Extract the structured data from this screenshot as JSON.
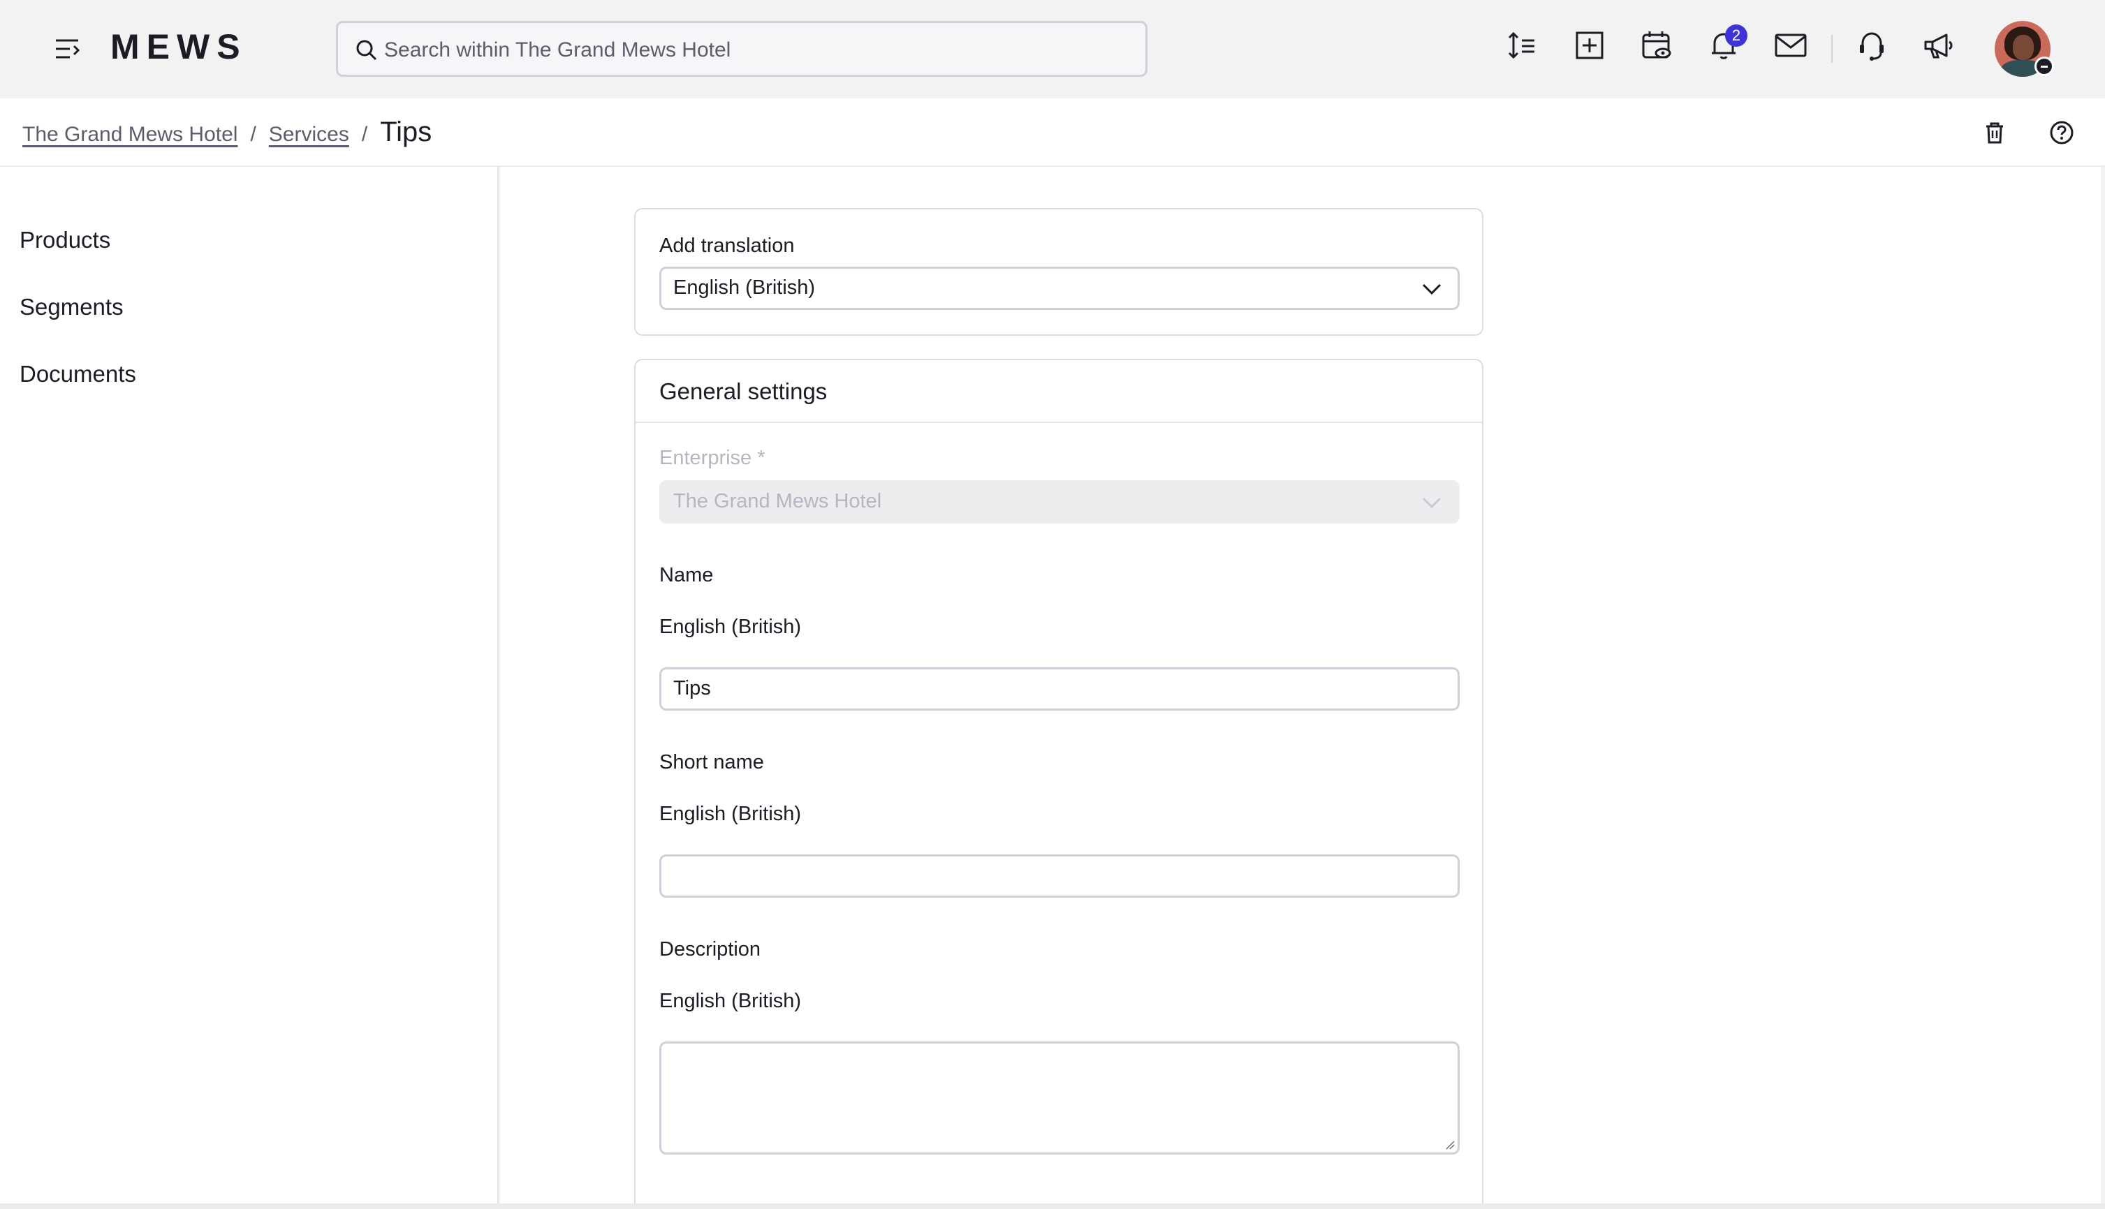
{
  "app": {
    "logo_text": "MEWS"
  },
  "search": {
    "placeholder": "Search within The Grand Mews Hotel"
  },
  "topbar": {
    "icons": [
      "line-spacing-icon",
      "add-square-icon",
      "calendar-view-icon",
      "bell-icon",
      "mail-icon",
      "headset-icon",
      "megaphone-icon"
    ],
    "notification_count": "2"
  },
  "breadcrumb": {
    "items": [
      "The Grand Mews Hotel",
      "Services"
    ],
    "separator": "/",
    "current": "Tips"
  },
  "sidebar": {
    "items": [
      {
        "label": "Products"
      },
      {
        "label": "Segments"
      },
      {
        "label": "Documents"
      }
    ]
  },
  "translation": {
    "label": "Add translation",
    "selected": "English (British)"
  },
  "general_settings": {
    "title": "General settings",
    "enterprise_label": "Enterprise *",
    "enterprise_value": "The Grand Mews Hotel",
    "name_label": "Name",
    "name_lang": "English (British)",
    "name_value": "Tips",
    "short_name_label": "Short name",
    "short_name_lang": "English (British)",
    "short_name_value": "",
    "description_label": "Description",
    "description_lang": "English (British)",
    "description_value": ""
  },
  "colors": {
    "accent": "#3d33d6",
    "text": "#1c1d24",
    "muted": "#5b5d6b",
    "border": "#cfd0d8"
  }
}
